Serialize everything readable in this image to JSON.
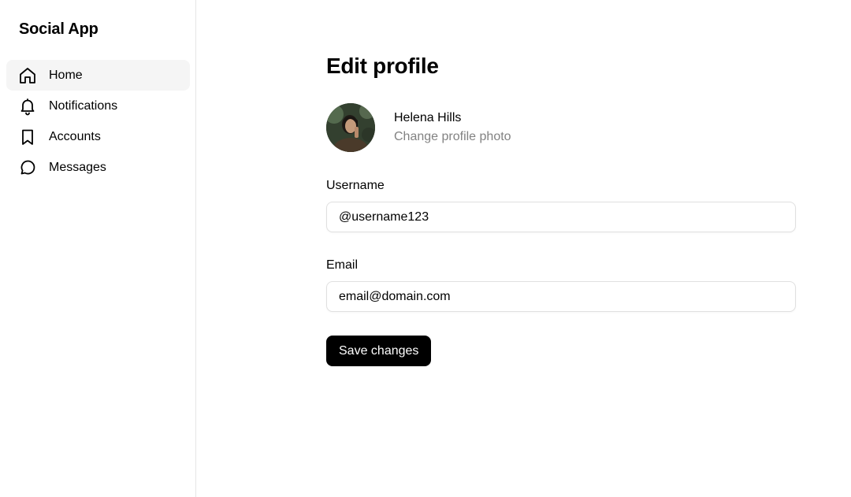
{
  "sidebar": {
    "app_title": "Social App",
    "items": [
      {
        "label": "Home",
        "icon": "home-icon",
        "active": true
      },
      {
        "label": "Notifications",
        "icon": "bell-icon",
        "active": false
      },
      {
        "label": "Accounts",
        "icon": "bookmark-icon",
        "active": false
      },
      {
        "label": "Messages",
        "icon": "message-circle-icon",
        "active": false
      }
    ]
  },
  "main": {
    "title": "Edit profile",
    "profile": {
      "name": "Helena Hills",
      "change_photo_label": "Change profile photo",
      "avatar_icon": "avatar-photo"
    },
    "username": {
      "label": "Username",
      "value": "@username123"
    },
    "email": {
      "label": "Email",
      "value": "email@domain.com"
    },
    "save_label": "Save changes"
  },
  "colors": {
    "primary_button": "#000000",
    "muted_text": "#828282",
    "active_nav_bg": "#f5f5f5",
    "border": "#e0e0e0"
  }
}
